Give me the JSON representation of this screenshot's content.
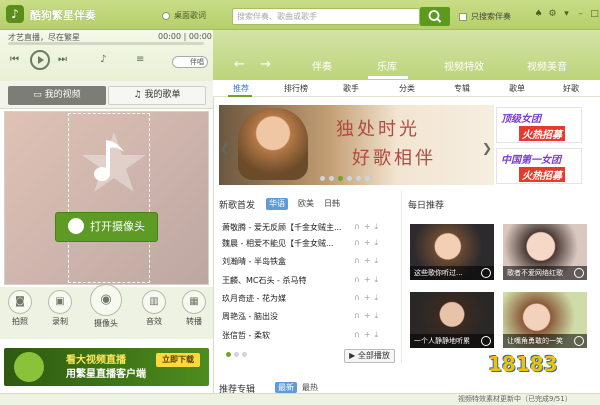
{
  "titlebar": {
    "app_title": "酷狗繁星伴奏",
    "lyric_toggle": "桌面歌词",
    "search_placeholder": "搜索伴奏、歌曲或歌手",
    "only_singer": "只搜索伴奏"
  },
  "player": {
    "tagline": "才艺直播，尽在繁星",
    "time": "00:00 | 00:00",
    "sing_toggle": "伴唱"
  },
  "nav": {
    "tabs": [
      "伴奏",
      "乐库",
      "视频特效",
      "视频美音"
    ],
    "active": "乐库"
  },
  "left_tabs": {
    "video": "我的视频",
    "songs": "我的歌单"
  },
  "camera": {
    "open_label": "打开摄像头"
  },
  "tools": [
    "拍照",
    "录制",
    "摄像头",
    "音效",
    "转播"
  ],
  "ad": {
    "line1": "看大视频直播",
    "line2": "用繁星直播客户端",
    "button": "立即下载"
  },
  "subtabs": [
    "推荐",
    "排行榜",
    "歌手",
    "分类",
    "专辑",
    "歌单",
    "好歌"
  ],
  "banner": {
    "line1": "独处时光",
    "line2": "好歌相伴",
    "side_ads": [
      {
        "l1": "顶级女团",
        "l2": "火热招募"
      },
      {
        "l1": "中国第一女团",
        "l2": "火热招募"
      }
    ]
  },
  "new_songs": {
    "title": "新歌首发",
    "filters": [
      "华语",
      "欧美",
      "日韩"
    ],
    "active_filter": "华语",
    "songs": [
      "萧敬腾 - 爱无反顾【千金女贼主...",
      "魏晨 - 相爱不能见【千金女贼...",
      "刘瀚晴 - 半岛铁盒",
      "王麟、MC石头 - 杀马特",
      "玖月奇迹 - 花为媒",
      "周艳泓 - 脑出没",
      "张信哲 - 柔软"
    ],
    "play_all": "全部播放"
  },
  "daily": {
    "title": "每日推荐",
    "picks": [
      "这些歌你听过...",
      "歌者不爱网络红歌",
      "一个人静静地听累",
      "让嘴角勇敢的一笑"
    ]
  },
  "recommended": {
    "title": "推荐专辑",
    "filters": [
      "最新",
      "最热"
    ]
  },
  "status": "视频特效素材更新中（已完成9/51）",
  "watermark": "18183",
  "colors": {
    "brand_green": "#5e9b25",
    "title_bar": "#bcd47a",
    "accent_blue": "#5e9bd8"
  }
}
